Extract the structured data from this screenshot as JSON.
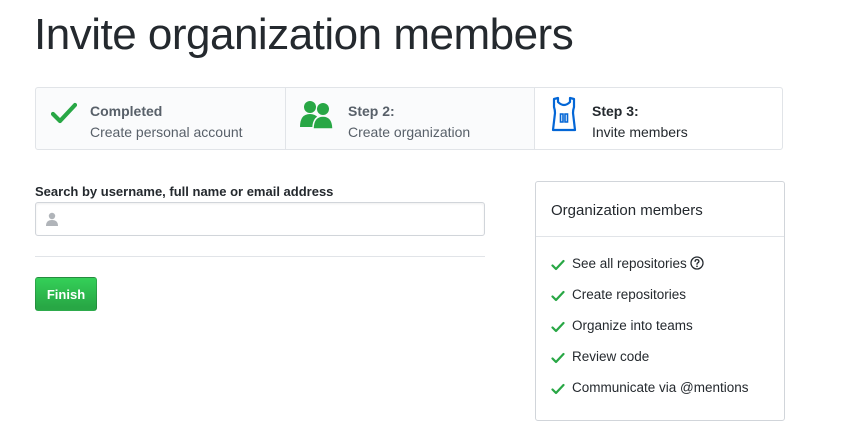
{
  "page": {
    "title": "Invite organization members"
  },
  "steps": [
    {
      "label": "Completed",
      "description": "Create personal account",
      "icon": "check-icon"
    },
    {
      "label": "Step 2:",
      "description": "Create organization",
      "icon": "people-icon"
    },
    {
      "label": "Step 3:",
      "description": "Invite members",
      "icon": "jersey-icon"
    }
  ],
  "search": {
    "label": "Search by username, full name or email address",
    "value": "",
    "placeholder": ""
  },
  "actions": {
    "finish_label": "Finish"
  },
  "members_panel": {
    "title": "Organization members",
    "items": [
      {
        "text": "See all repositories",
        "has_help": true
      },
      {
        "text": "Create repositories",
        "has_help": false
      },
      {
        "text": "Organize into teams",
        "has_help": false
      },
      {
        "text": "Review code",
        "has_help": false
      },
      {
        "text": "Communicate via @mentions",
        "has_help": false
      }
    ]
  },
  "colors": {
    "green": "#28a745",
    "blue": "#0366d6",
    "text": "#24292e",
    "muted": "#586069",
    "border": "#e1e4e8"
  }
}
